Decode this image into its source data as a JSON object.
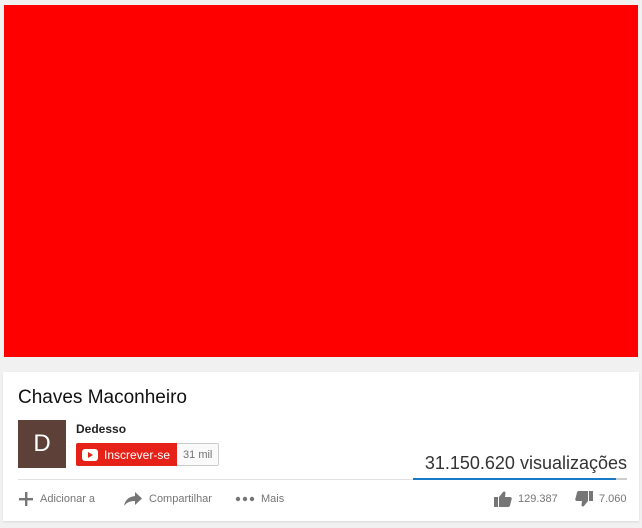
{
  "video": {
    "title": "Chaves Maconheiro",
    "player_color": "#ff0000"
  },
  "channel": {
    "avatar_letter": "D",
    "name": "Dedesso",
    "subscribe_label": "Inscrever-se",
    "subscriber_count": "31 mil"
  },
  "stats": {
    "views": "31.150.620 visualizações",
    "likes": "129.387",
    "dislikes": "7.060",
    "like_ratio": 0.948
  },
  "actions": {
    "add_label": "Adicionar a",
    "share_label": "Compartilhar",
    "more_label": "Mais"
  },
  "icons": {
    "add": "plus-icon",
    "share": "share-arrow-icon",
    "more": "more-dots-icon",
    "like": "thumbs-up-icon",
    "dislike": "thumbs-down-icon",
    "subscribe": "youtube-logo-icon"
  },
  "colors": {
    "accent_red": "#e62117",
    "sentiment_blue": "#167ac6",
    "avatar_bg": "#5d4037"
  }
}
